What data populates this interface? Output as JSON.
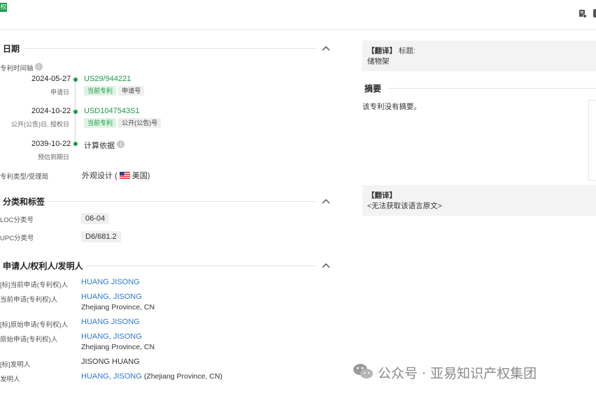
{
  "top": {
    "badge": "权"
  },
  "dates_section": {
    "title": "日期",
    "timeline_label": "专利时间轴",
    "events": [
      {
        "date": "2024-05-27",
        "sub": "申请日",
        "number": "US29/944221",
        "tags": [
          "当前专利",
          "申请号"
        ]
      },
      {
        "date": "2024-10-22",
        "sub": "公开(公告)日, 授权日",
        "number": "USD1047543S1",
        "tags": [
          "当前专利",
          "公开(公告)号"
        ]
      },
      {
        "date": "2039-10-22",
        "sub": "预估到期日",
        "number": "计算依据"
      }
    ],
    "type_label": "专利类型/受理局",
    "type_value_prefix": "外观设计 (",
    "type_value_country": "美国)"
  },
  "classification": {
    "title": "分类和标签",
    "loc_label": "LOC分类号",
    "loc_value": "06-04",
    "upc_label": "UPC分类号",
    "upc_value": "D6/681.2"
  },
  "parties": {
    "title": "申请人/权利人/发明人",
    "rows": [
      {
        "label": "[标]当前申请(专利权)人",
        "name": "HUANG JISONG",
        "addr": ""
      },
      {
        "label": "当前申请(专利权)人",
        "name": "HUANG, JISONG",
        "addr": "Zhejiang Province, CN"
      },
      {
        "label": "[标]原始申请(专利权)人",
        "name": "HUANG JISONG",
        "addr": ""
      },
      {
        "label": "原始申请(专利权)人",
        "name": "HUANG, JISONG",
        "addr": "Zhejiang Province, CN"
      },
      {
        "label": "[标]发明人",
        "name": "JISONG HUANG",
        "addr": ""
      },
      {
        "label": "发明人",
        "name": "HUANG, JISONG",
        "addr": "(Zhejiang Province, CN)"
      }
    ]
  },
  "right": {
    "translate_tag": "【翻译】",
    "title_label": "标题:",
    "title_value": "储物架",
    "abstract_title": "摘要",
    "abstract_text": "该专利没有摘要。",
    "translate_tag2": "【翻译】",
    "no_original": "<无法获取该语言原文>"
  },
  "watermark": "公众号 · 亚易知识产权集团",
  "colors": {
    "green": "#1a9a4c",
    "link": "#2a7ad4"
  }
}
